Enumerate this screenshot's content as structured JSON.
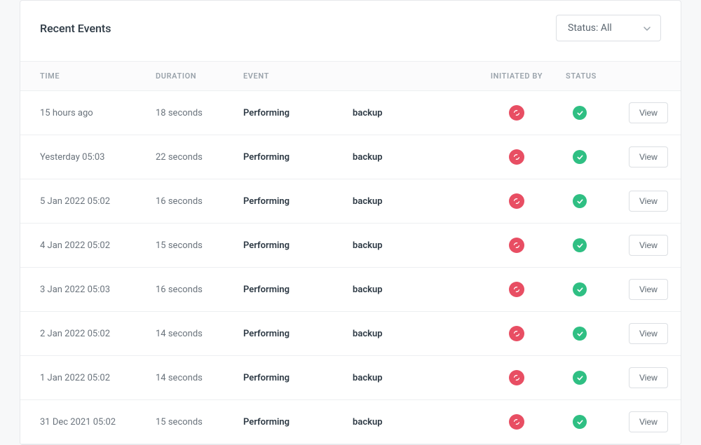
{
  "header": {
    "title": "Recent Events",
    "status_filter_label": "Status: All"
  },
  "columns": {
    "time": "TIME",
    "duration": "DURATION",
    "event": "EVENT",
    "initiated_by": "INITIATED BY",
    "status": "STATUS"
  },
  "action_label": "View",
  "rows": [
    {
      "time": "15 hours ago",
      "duration": "18 seconds",
      "event_prefix": "Performing",
      "event_suffix": "backup",
      "initiator": "system",
      "status": "success"
    },
    {
      "time": "Yesterday 05:03",
      "duration": "22 seconds",
      "event_prefix": "Performing",
      "event_suffix": "backup",
      "initiator": "system",
      "status": "success"
    },
    {
      "time": "5 Jan 2022 05:02",
      "duration": "16 seconds",
      "event_prefix": "Performing",
      "event_suffix": "backup",
      "initiator": "system",
      "status": "success"
    },
    {
      "time": "4 Jan 2022 05:02",
      "duration": "15 seconds",
      "event_prefix": "Performing",
      "event_suffix": "backup",
      "initiator": "system",
      "status": "success"
    },
    {
      "time": "3 Jan 2022 05:03",
      "duration": "16 seconds",
      "event_prefix": "Performing",
      "event_suffix": "backup",
      "initiator": "system",
      "status": "success"
    },
    {
      "time": "2 Jan 2022 05:02",
      "duration": "14 seconds",
      "event_prefix": "Performing",
      "event_suffix": "backup",
      "initiator": "system",
      "status": "success"
    },
    {
      "time": "1 Jan 2022 05:02",
      "duration": "14 seconds",
      "event_prefix": "Performing",
      "event_suffix": "backup",
      "initiator": "system",
      "status": "success"
    },
    {
      "time": "31 Dec 2021 05:02",
      "duration": "15 seconds",
      "event_prefix": "Performing",
      "event_suffix": "backup",
      "initiator": "system",
      "status": "success"
    }
  ],
  "colors": {
    "initiator_badge": "#e84e63",
    "success_badge": "#2fbf83"
  }
}
